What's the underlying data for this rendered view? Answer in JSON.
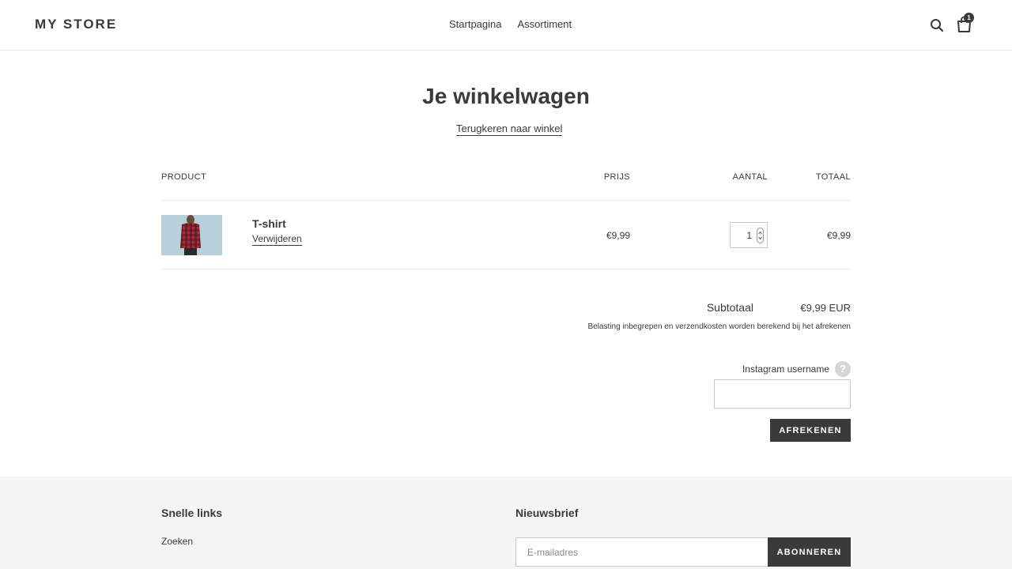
{
  "header": {
    "logo": "MY STORE",
    "nav": [
      "Startpagina",
      "Assortiment"
    ],
    "search_icon": "search-icon",
    "cart_icon": "shopping-bag-icon",
    "cart_count": "1"
  },
  "cart": {
    "title": "Je winkelwagen",
    "back_link": "Terugkeren naar winkel",
    "columns": {
      "product": "PRODUCT",
      "price": "PRIJS",
      "quantity": "AANTAL",
      "total": "TOTAAL"
    },
    "items": [
      {
        "name": "T-shirt",
        "remove_label": "Verwijderen",
        "price": "€9,99",
        "quantity": "1",
        "total": "€9,99",
        "image_colors": {
          "background": "#b8d0da",
          "shirt": "#b3283a",
          "check": "#3a1a1f"
        }
      }
    ],
    "subtotal_label": "Subtotaal",
    "subtotal_value": "€9,99 EUR",
    "tax_note": "Belasting inbegrepen en verzendkosten worden berekend bij het afrekenen",
    "instagram_label": "Instagram username",
    "instagram_value": "",
    "help_glyph": "?",
    "checkout_label": "AFREKENEN"
  },
  "footer": {
    "quick_links_title": "Snelle links",
    "quick_links": [
      "Zoeken"
    ],
    "newsletter_title": "Nieuwsbrief",
    "email_placeholder": "E-mailadres",
    "subscribe_label": "ABONNEREN"
  },
  "colors": {
    "text": "#3a3a3a",
    "button_bg": "#3a3a3a",
    "footer_bg": "#f5f5f5",
    "border": "#e8e9eb"
  }
}
